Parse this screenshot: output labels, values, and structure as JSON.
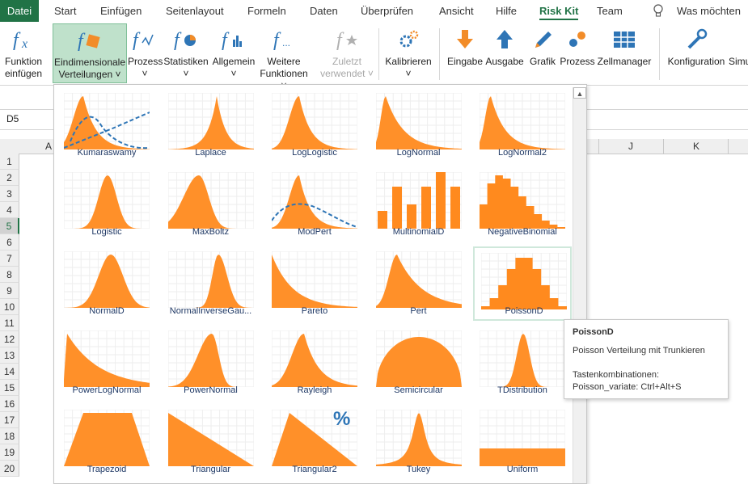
{
  "tabs": [
    "Datei",
    "Start",
    "Einfügen",
    "Seitenlayout",
    "Formeln",
    "Daten",
    "Überprüfen",
    "Ansicht",
    "Hilfe",
    "Risk Kit",
    "Team"
  ],
  "active_tab": "Risk Kit",
  "tell_me": "Was möchten S",
  "ribbon": {
    "funktion": [
      "Funktion",
      "einfügen"
    ],
    "eindim": [
      "Eindimensionale",
      "Verteilungen ˅"
    ],
    "prozess": [
      "Prozess",
      "˅"
    ],
    "statistiken": [
      "Statistiken",
      "˅"
    ],
    "allgemein": [
      "Allgemein",
      "˅"
    ],
    "weitere": [
      "Weitere",
      "Funktionen ˅"
    ],
    "zuletzt": [
      "Zuletzt",
      "verwendet ˅"
    ],
    "kalibrieren": [
      "Kalibrieren",
      "˅"
    ],
    "eingabe": "Eingabe",
    "ausgabe": "Ausgabe",
    "grafik": "Grafik",
    "prozess2": "Prozess",
    "zellmanager": "Zellmanager",
    "konfiguration": "Konfiguration",
    "simu": "Simu"
  },
  "namebox": "D5",
  "columns": {
    "A": "A",
    "J": "J",
    "K": "K"
  },
  "rows": [
    "1",
    "2",
    "3",
    "4",
    "5",
    "6",
    "7",
    "8",
    "9",
    "10",
    "11",
    "12",
    "13",
    "14",
    "15",
    "16",
    "17",
    "18",
    "19",
    "20"
  ],
  "selected_row": "5",
  "gallery": [
    "Kumaraswamy",
    "Laplace",
    "LogLogistic",
    "LogNormal",
    "LogNormal2",
    "Logistic",
    "MaxBoltz",
    "ModPert",
    "MultinomialD",
    "NegativeBinomial",
    "NormalD",
    "NormalInverseGau...",
    "Pareto",
    "Pert",
    "PoissonD",
    "PowerLogNormal",
    "PowerNormal",
    "Rayleigh",
    "Semicircular",
    "TDistribution",
    "Trapezoid",
    "Triangular",
    "Triangular2",
    "Tukey",
    "Uniform"
  ],
  "hovered_item": "PoissonD",
  "tooltip": {
    "title": "PoissonD",
    "desc": "Poisson Verteilung mit Trunkieren",
    "keys_label": "Tastenkombinationen:",
    "keys": "Poisson_variate: Ctrl+Alt+S"
  },
  "percent_badge": "%",
  "colors": {
    "accent": "#217346",
    "orange": "#ff8a1e",
    "blue_dashed": "#2e75b6",
    "label": "#1f3864"
  }
}
